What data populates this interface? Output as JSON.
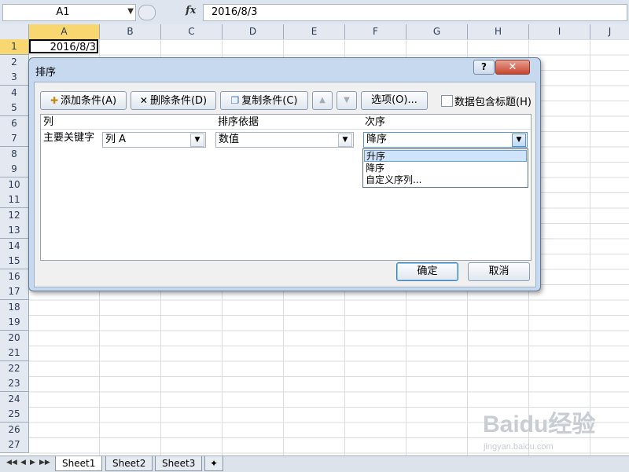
{
  "formula_bar": {
    "name_box": "A1",
    "fx_label": "fx",
    "formula": "2016/8/3"
  },
  "columns": [
    "A",
    "B",
    "C",
    "D",
    "E",
    "F",
    "G",
    "H",
    "I",
    "J"
  ],
  "rows": [
    "1",
    "2",
    "3",
    "4",
    "5",
    "6",
    "7",
    "8",
    "9",
    "10",
    "11",
    "12",
    "13",
    "14",
    "15",
    "16",
    "17",
    "18",
    "19",
    "20",
    "21",
    "22",
    "23",
    "24",
    "25",
    "26",
    "27"
  ],
  "cell_a1": "2016/8/3",
  "sheet_tabs": [
    "Sheet1",
    "Sheet2",
    "Sheet3"
  ],
  "dialog": {
    "title": "排序",
    "help": "?",
    "close": "✕",
    "add_condition": "添加条件(A)",
    "delete_condition": "删除条件(D)",
    "copy_condition": "复制条件(C)",
    "options": "选项(O)...",
    "header_checkbox_label": "数据包含标题(H)",
    "list_headers": {
      "column": "列",
      "sort_on": "排序依据",
      "order": "次序"
    },
    "row": {
      "label": "主要关键字",
      "column_value": "列 A",
      "sort_on_value": "数值",
      "order_value": "降序"
    },
    "order_options": [
      "升序",
      "降序",
      "自定义序列..."
    ],
    "ok": "确定",
    "cancel": "取消"
  },
  "watermark": {
    "main": "Baidu经验",
    "sub": "jingyan.baidu.com"
  }
}
